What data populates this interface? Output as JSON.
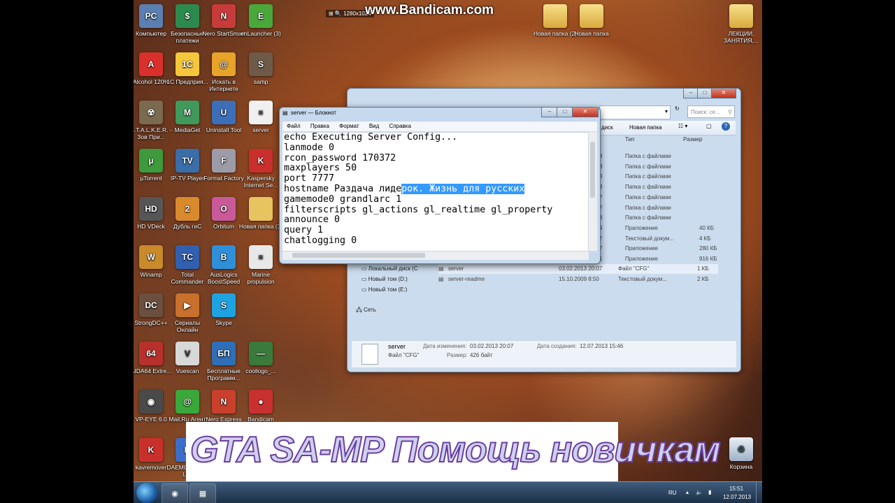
{
  "watermark": "www.Bandicam.com",
  "recording_bar": "1280x1024",
  "desktop_icons": [
    {
      "label": "Компьютер",
      "color": "#5b7fb0",
      "glyph": "PC"
    },
    {
      "label": "Безопасные платежи",
      "color": "#2d8a4e",
      "glyph": "$"
    },
    {
      "label": "Nero StartSmart",
      "color": "#c73b3b",
      "glyph": "N"
    },
    {
      "label": "enLauncher (3)",
      "color": "#4aa83a",
      "glyph": "E"
    },
    {
      "label": "Alcohol 120%",
      "color": "#d9302c",
      "glyph": "A"
    },
    {
      "label": "1С Предприя...",
      "color": "#f5c73a",
      "glyph": "1С"
    },
    {
      "label": "Искать в Интернете",
      "color": "#e8a32b",
      "glyph": "@"
    },
    {
      "label": "samp",
      "color": "#6e5a48",
      "glyph": "S"
    },
    {
      "label": "S.T.A.L.K.E.R. - Зов При...",
      "color": "#7a6a50",
      "glyph": "☢"
    },
    {
      "label": "MediaGet",
      "color": "#3f9a5c",
      "glyph": "M"
    },
    {
      "label": "Uninstall Tool",
      "color": "#3d6fb8",
      "glyph": "U"
    },
    {
      "label": "server",
      "color": "#f0f0f0",
      "glyph": "≡"
    },
    {
      "label": "µTorrent",
      "color": "#3d9a3d",
      "glyph": "µ"
    },
    {
      "label": "IP-TV Player",
      "color": "#3a6ea8",
      "glyph": "TV"
    },
    {
      "label": "Format Factory",
      "color": "#9c9ca8",
      "glyph": "F"
    },
    {
      "label": "Kaspersky Internet Se...",
      "color": "#c9302c",
      "glyph": "K"
    },
    {
      "label": "HD VDeck",
      "color": "#565656",
      "glyph": "HD"
    },
    {
      "label": "Дубль гиС",
      "color": "#d88a2c",
      "glyph": "2"
    },
    {
      "label": "Orbitum",
      "color": "#c95a9a",
      "glyph": "O"
    },
    {
      "label": "Новая папка (3)",
      "color": "#e8c460",
      "glyph": ""
    },
    {
      "label": "Winamp",
      "color": "#c98a2c",
      "glyph": "W"
    },
    {
      "label": "Total Commander",
      "color": "#3160b0",
      "glyph": "TC"
    },
    {
      "label": "AusLogics BoostSpeed",
      "color": "#2f8fd8",
      "glyph": "B"
    },
    {
      "label": "Marine propulsion",
      "color": "#e8e8e8",
      "glyph": "≡"
    },
    {
      "label": "StrongDC++",
      "color": "#6b5040",
      "glyph": "DC"
    },
    {
      "label": "Сериалы Онлайн",
      "color": "#c8702c",
      "glyph": "▶"
    },
    {
      "label": "Skype",
      "color": "#1ea3e0",
      "glyph": "S"
    },
    {
      "label": "",
      "color": "transparent",
      "glyph": ""
    },
    {
      "label": "AIDA64 Extre...",
      "color": "#b8302c",
      "glyph": "64"
    },
    {
      "label": "Vuescan",
      "color": "#d8d8d8",
      "glyph": "V"
    },
    {
      "label": "Бесплатные Программ...",
      "color": "#2f6fb8",
      "glyph": "БП"
    },
    {
      "label": "coollogo_...",
      "color": "#3a7a3a",
      "glyph": "—"
    },
    {
      "label": "VP-EYE 6.0",
      "color": "#4a4a4a",
      "glyph": "◉"
    },
    {
      "label": "Mail.Ru Агент",
      "color": "#3aa83a",
      "glyph": "@"
    },
    {
      "label": "Nero Express",
      "color": "#c9402c",
      "glyph": "N"
    },
    {
      "label": "Bandicam",
      "color": "#c93030",
      "glyph": "●"
    },
    {
      "label": "kavremover",
      "color": "#c9302c",
      "glyph": "K"
    },
    {
      "label": "DAEMON Tools Lite",
      "color": "#3a6ec8",
      "glyph": "D"
    }
  ],
  "right_icons": [
    {
      "label": "Новая папка (2)"
    },
    {
      "label": "Новая папка"
    },
    {
      "label": "ЛЕКЦИИ, ЗАНЯТИЯ,..."
    },
    {
      "label": "Корзина"
    }
  ],
  "explorer": {
    "search_placeholder": "Поиск: се...",
    "toolbar_label_1": "диск",
    "toolbar_label_2": "Новая папка",
    "col_type": "Тип",
    "col_size": "Размер",
    "rows": [
      {
        "date": "3",
        "type": "Папка с файлами",
        "size": ""
      },
      {
        "date": "3",
        "type": "Папка с файлами",
        "size": ""
      },
      {
        "date": "3",
        "type": "Папка с файлами",
        "size": ""
      },
      {
        "date": "3",
        "type": "Папка с файлами",
        "size": ""
      },
      {
        "date": "7",
        "type": "Папка с файлами",
        "size": ""
      },
      {
        "date": "7",
        "type": "Папка с файлами",
        "size": ""
      },
      {
        "date": "3",
        "type": "Папка с файлами",
        "size": ""
      },
      {
        "date": "4",
        "type": "Приложение",
        "size": "40 КБ"
      },
      {
        "date": "7",
        "type": "Текстовый докум...",
        "size": "4 КБ"
      },
      {
        "date": "7",
        "type": "Приложение",
        "size": "280 КБ"
      },
      {
        "date": "1",
        "type": "Приложение",
        "size": "916 КБ"
      }
    ],
    "files": [
      {
        "name": "server",
        "date": "03.02.2013 20:07",
        "type": "Файл \"CFG\"",
        "size": "1 КБ"
      },
      {
        "name": "server-readme",
        "date": "15.10.2009 8:50",
        "type": "Текстовый докум...",
        "size": "2 КБ"
      }
    ],
    "nav": [
      "Локальный диск (C",
      "Новый том (D:)",
      "Новый том (E:)",
      "Сеть"
    ],
    "details": {
      "name": "server",
      "type": "Файл \"CFG\"",
      "modified_label": "Дата изменения:",
      "modified": "03.02.2013 20:07",
      "size_label": "Размер:",
      "size": "426 байт",
      "created_label": "Дата создания:",
      "created": "12.07.2013 15:46"
    }
  },
  "notepad": {
    "title": "server — Блокнот",
    "menu": [
      "Файл",
      "Правка",
      "Формат",
      "Вид",
      "Справка"
    ],
    "lines": [
      "echo Executing Server Config...",
      "lanmode 0",
      "rcon_password 170372",
      "maxplayers 50",
      "port 7777",
      "hostname Раздача лиде",
      "gamemode0 grandlarc 1",
      "filterscripts gl_actions gl_realtime gl_property",
      "announce 0",
      "query 1",
      "chatlogging 0"
    ],
    "selected_fragment": "рок. Жизнь для русских"
  },
  "banner_text": "GTA SA-MP Помощь новичкам",
  "taskbar": {
    "lang": "RU",
    "time": "15:51",
    "date": "12.07.2013"
  }
}
